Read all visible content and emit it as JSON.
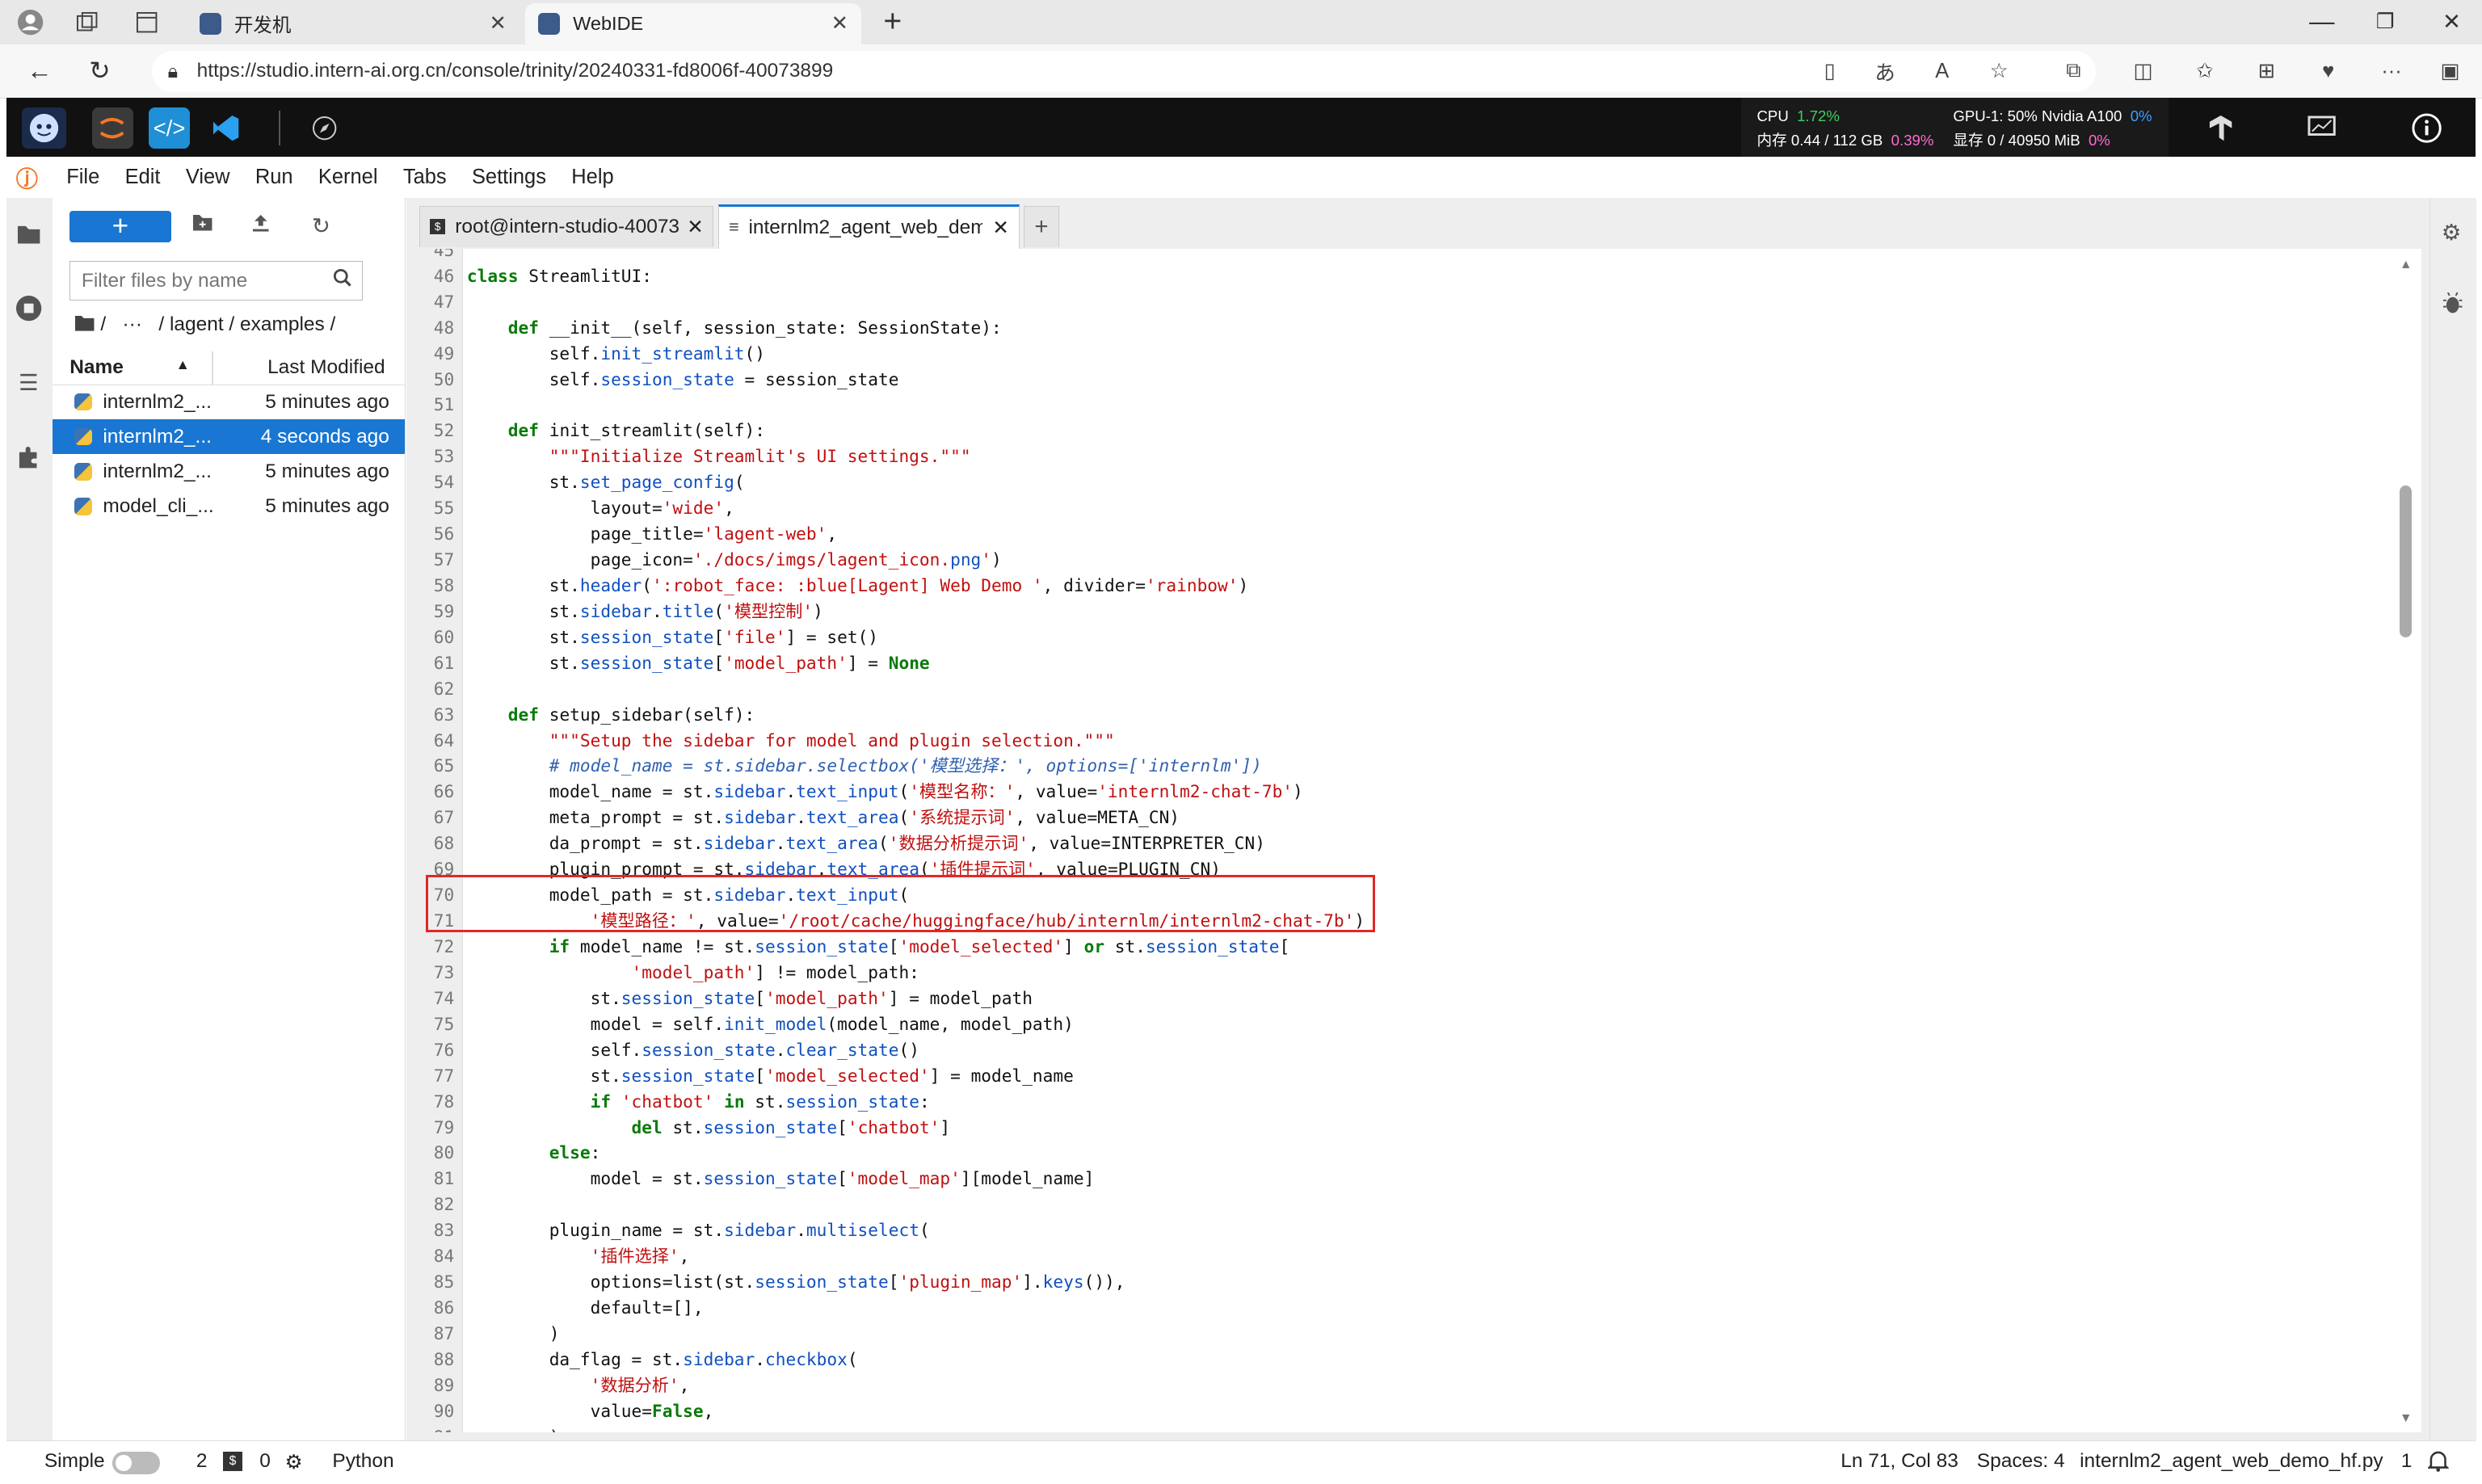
{
  "browser": {
    "tabs": [
      {
        "title": "开发机",
        "active": false
      },
      {
        "title": "WebIDE",
        "active": true
      }
    ],
    "url": "https://studio.intern-ai.org.cn/console/trinity/20240331-fd8006f-40073899"
  },
  "topbar": {
    "cpu_label": "CPU",
    "cpu_value": "1.72%",
    "mem_label": "内存 0.44 / 112 GB",
    "mem_value": "0.39%",
    "gpu_label": "GPU-1: 50% Nvidia A100",
    "gpu_value": "0%",
    "vram_label": "显存 0 / 40950 MiB",
    "vram_value": "0%"
  },
  "menu": [
    "File",
    "Edit",
    "View",
    "Run",
    "Kernel",
    "Tabs",
    "Settings",
    "Help"
  ],
  "filebrowser": {
    "new_label": "+",
    "filter_placeholder": "Filter files by name",
    "breadcrumb": "/   ···   / lagent / examples /",
    "col_name": "Name",
    "col_modified": "Last Modified",
    "files": [
      {
        "name": "internlm2_...",
        "modified": "5 minutes ago",
        "selected": false
      },
      {
        "name": "internlm2_...",
        "modified": "4 seconds ago",
        "selected": true
      },
      {
        "name": "internlm2_...",
        "modified": "5 minutes ago",
        "selected": false
      },
      {
        "name": "model_cli_...",
        "modified": "5 minutes ago",
        "selected": false
      }
    ]
  },
  "doc_tabs": [
    {
      "title": "root@intern-studio-40073",
      "active": false
    },
    {
      "title": "internlm2_agent_web_dem",
      "active": true
    }
  ],
  "code_lines": [
    {
      "n": "45",
      "t": ""
    },
    {
      "n": "46",
      "t": "class StreamlitUI:"
    },
    {
      "n": "47",
      "t": ""
    },
    {
      "n": "48",
      "t": "    def __init__(self, session_state: SessionState):"
    },
    {
      "n": "49",
      "t": "        self.init_streamlit()"
    },
    {
      "n": "50",
      "t": "        self.session_state = session_state"
    },
    {
      "n": "51",
      "t": ""
    },
    {
      "n": "52",
      "t": "    def init_streamlit(self):"
    },
    {
      "n": "53",
      "t": "        \"\"\"Initialize Streamlit's UI settings.\"\"\""
    },
    {
      "n": "54",
      "t": "        st.set_page_config("
    },
    {
      "n": "55",
      "t": "            layout='wide',"
    },
    {
      "n": "56",
      "t": "            page_title='lagent-web',"
    },
    {
      "n": "57",
      "t": "            page_icon='./docs/imgs/lagent_icon.png')"
    },
    {
      "n": "58",
      "t": "        st.header(':robot_face: :blue[Lagent] Web Demo ', divider='rainbow')"
    },
    {
      "n": "59",
      "t": "        st.sidebar.title('模型控制')"
    },
    {
      "n": "60",
      "t": "        st.session_state['file'] = set()"
    },
    {
      "n": "61",
      "t": "        st.session_state['model_path'] = None"
    },
    {
      "n": "62",
      "t": ""
    },
    {
      "n": "63",
      "t": "    def setup_sidebar(self):"
    },
    {
      "n": "64",
      "t": "        \"\"\"Setup the sidebar for model and plugin selection.\"\"\""
    },
    {
      "n": "65",
      "t": "        # model_name = st.sidebar.selectbox('模型选择：', options=['internlm'])"
    },
    {
      "n": "66",
      "t": "        model_name = st.sidebar.text_input('模型名称：', value='internlm2-chat-7b')"
    },
    {
      "n": "67",
      "t": "        meta_prompt = st.sidebar.text_area('系统提示词', value=META_CN)"
    },
    {
      "n": "68",
      "t": "        da_prompt = st.sidebar.text_area('数据分析提示词', value=INTERPRETER_CN)"
    },
    {
      "n": "69",
      "t": "        plugin_prompt = st.sidebar.text_area('插件提示词', value=PLUGIN_CN)"
    },
    {
      "n": "70",
      "t": "        model_path = st.sidebar.text_input("
    },
    {
      "n": "71",
      "t": "            '模型路径：', value='/root/cache/huggingface/hub/internlm/internlm2-chat-7b')"
    },
    {
      "n": "72",
      "t": "        if model_name != st.session_state['model_selected'] or st.session_state["
    },
    {
      "n": "73",
      "t": "                'model_path'] != model_path:"
    },
    {
      "n": "74",
      "t": "            st.session_state['model_path'] = model_path"
    },
    {
      "n": "75",
      "t": "            model = self.init_model(model_name, model_path)"
    },
    {
      "n": "76",
      "t": "            self.session_state.clear_state()"
    },
    {
      "n": "77",
      "t": "            st.session_state['model_selected'] = model_name"
    },
    {
      "n": "78",
      "t": "            if 'chatbot' in st.session_state:"
    },
    {
      "n": "79",
      "t": "                del st.session_state['chatbot']"
    },
    {
      "n": "80",
      "t": "        else:"
    },
    {
      "n": "81",
      "t": "            model = st.session_state['model_map'][model_name]"
    },
    {
      "n": "82",
      "t": ""
    },
    {
      "n": "83",
      "t": "        plugin_name = st.sidebar.multiselect("
    },
    {
      "n": "84",
      "t": "            '插件选择',"
    },
    {
      "n": "85",
      "t": "            options=list(st.session_state['plugin_map'].keys()),"
    },
    {
      "n": "86",
      "t": "            default=[],"
    },
    {
      "n": "87",
      "t": "        )"
    },
    {
      "n": "88",
      "t": "        da_flag = st.sidebar.checkbox("
    },
    {
      "n": "89",
      "t": "            '数据分析',"
    },
    {
      "n": "90",
      "t": "            value=False,"
    },
    {
      "n": "91",
      "t": "        )"
    }
  ],
  "statusbar": {
    "mode": "Simple",
    "terminals": "2",
    "kernels": "0",
    "kernel_name": "Python",
    "cursor": "Ln 71, Col 83",
    "spaces": "Spaces: 4",
    "filename": "internlm2_agent_web_demo_hf.py",
    "notifications": "1"
  },
  "colors": {
    "accent": "#1976d2",
    "highlight_box": "#e02828",
    "topbar_bg": "#111111"
  }
}
